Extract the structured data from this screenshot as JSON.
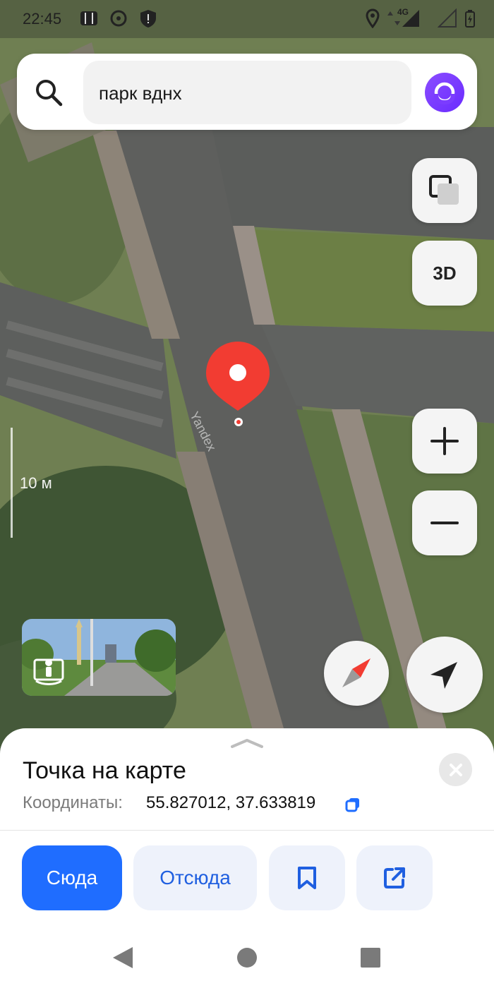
{
  "status_bar": {
    "time": "22:45",
    "network": "4G",
    "icons": [
      "maps-icon",
      "vpn-key-icon",
      "shield-icon",
      "location-icon",
      "data-arrows-icon",
      "signal-icon",
      "wifi-off-icon",
      "battery-icon"
    ]
  },
  "search": {
    "query": "парк вднх",
    "search_icon": "search-icon",
    "assistant_icon": "alice-icon"
  },
  "map": {
    "scale_label": "10 м",
    "watermark": "Yandex",
    "controls": {
      "layers_icon": "layers-icon",
      "three_d_label": "3D",
      "zoom_in_icon": "plus-icon",
      "zoom_out_icon": "minus-icon",
      "compass_icon": "compass-icon",
      "my_location_icon": "navigation-arrow-icon"
    },
    "panorama_icon": "street-view-icon",
    "pin_color": "#f23c32"
  },
  "place_card": {
    "title": "Точка на карте",
    "coordinates_label": "Координаты:",
    "coordinates_value": "55.827012, 37.633819",
    "copy_icon": "copy-icon",
    "close_icon": "close-icon"
  },
  "actions": {
    "route_to": "Сюда",
    "route_from": "Отсюда",
    "bookmark_icon": "bookmark-icon",
    "share_icon": "share-icon"
  },
  "nav_bar": {
    "back_icon": "back-triangle-icon",
    "home_icon": "home-circle-icon",
    "recents_icon": "recents-square-icon"
  },
  "colors": {
    "accent": "#1f6dff",
    "secondary_bg": "#eef2fb",
    "alice": "#7b3cff",
    "pin": "#f23c32"
  }
}
